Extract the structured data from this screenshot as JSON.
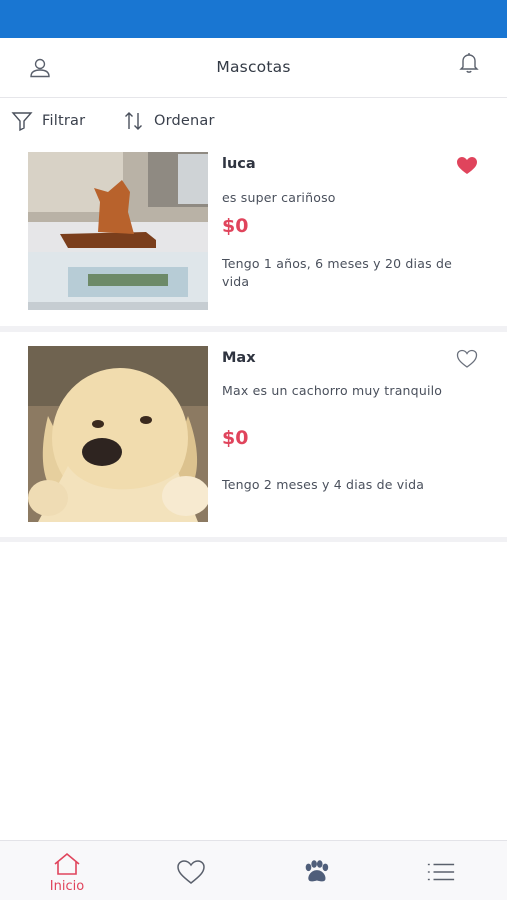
{
  "header": {
    "title": "Mascotas"
  },
  "toolbar": {
    "filter_label": "Filtrar",
    "sort_label": "Ordenar"
  },
  "pets": [
    {
      "name": "luca",
      "description": "es super cariñoso",
      "price": "$0",
      "age": "Tengo 1 años, 6 meses y 20 dias de vida",
      "favorite": true,
      "photo_icon": "cat-figurine-photo"
    },
    {
      "name": "Max",
      "description": "Max es un cachorro muy tranquilo",
      "price": "$0",
      "age": "Tengo 2 meses y 4 dias de vida",
      "favorite": false,
      "photo_icon": "puppy-photo"
    }
  ],
  "bottom_nav": {
    "home_label": "Inicio",
    "active": "home",
    "items": [
      "home-icon",
      "heart-icon",
      "paw-icon",
      "list-icon"
    ]
  },
  "colors": {
    "status_bar": "#1976d2",
    "accent": "#e0445c",
    "text": "#2f3440"
  }
}
